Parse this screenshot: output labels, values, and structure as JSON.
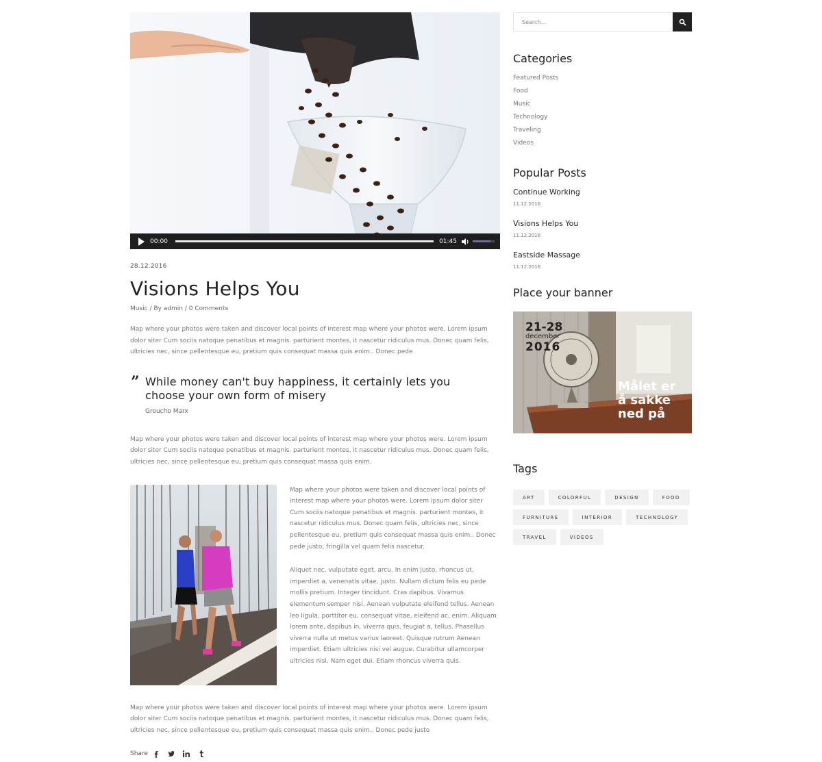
{
  "video": {
    "current_time": "00:00",
    "duration": "01:45",
    "progress": 0.0,
    "volume": 0.8
  },
  "post": {
    "date": "28.12.2016",
    "title": "Visions Helps You",
    "category": "Music",
    "by_label": "By",
    "author": "admin",
    "comments": "0 Comments",
    "paragraph_1": "Map where your photos were taken and discover local points of interest map where your photos were. Lorem ipsum dolor siter Cum sociis natoque penatibus et magnis. parturient montes, it nascetur ridiculus mus. Donec quam felis, ultricies nec, since pellentesque eu, pretium quis consequat massa quis enim.. Donec pede",
    "quote": "While money can't buy happiness, it certainly lets you choose your own form of misery",
    "quote_author": "Groucho Marx",
    "paragraph_2": "Map where your photos were taken and discover local points of interest map where your photos were. Lorem ipsum dolor siter Cum sociis natoque penatibus et magnis. parturient montes, it nascetur ridiculus mus. Donec quam felis, ultricies nec, since pellentesque eu, pretium quis consequat massa quis enim.",
    "side_paragraph_1": "Map where your photos were taken and discover local points of interest map where your photos were. Lorem ipsum dolor siter Cum sociis natoque penatibus et magnis. parturient montes, it nascetur ridiculus mus. Donec quam felis, ultricies nec, since pellentesque eu, pretium quis consequat  massa quis enim.. Donec pede justo, fringilla vel quam felis nascetur.",
    "side_paragraph_2": "Aliquet nec, vulputate eget, arcu. In enim justo, rhoncus ut, imperdiet a, venenatis vitae, justo. Nullam dictum felis eu pede mollis pretium. Integer tincidunt. Cras dapibus. Vivamus elementum semper nisi. Aenean vulputate eleifend tellus. Aenean leo ligula, porttitor eu, consequat vitae, eleifend ac, enim. Aliquam lorem ante, dapibus in, viverra quis, feugiat a, tellus. Phasellus viverra nulla ut metus varius laoreet. Quisque rutrum Aenean imperdiet. Etiam ultricies nisi vel augue. Curabitur ullamcorper ultricies nisi. Nam eget dui. Etiam rhoncus viverra quis.",
    "paragraph_3": "Map where your photos were taken and discover local points of interest map where your photos were. Lorem ipsum dolor siter Cum sociis natoque penatibus et magnis. parturient montes, it nascetur ridiculus mus. Donec quam felis, ultricies nec, since pellentesque eu, pretium quis consequat massa quis enim.. Donec pede justo",
    "share_label": "Share",
    "share_icons": [
      "facebook-icon",
      "twitter-icon",
      "linkedin-icon",
      "tumblr-icon"
    ]
  },
  "sidebar": {
    "search_placeholder": "Search...",
    "categories_title": "Categories",
    "categories": [
      "Featured Posts",
      "Food",
      "Music",
      "Technology",
      "Traveling",
      "Videos"
    ],
    "popular_title": "Popular Posts",
    "popular": [
      {
        "title": "Continue Working",
        "date": "11.12.2016"
      },
      {
        "title": "Visions Helps You",
        "date": "11.12.2016"
      },
      {
        "title": "Eastside Massage",
        "date": "11.12.2016"
      }
    ],
    "banner_title": "Place your banner",
    "banner": {
      "date_range": "21-28",
      "month": "december",
      "year": "2016",
      "line1": "Målet er",
      "line2": "å sakke",
      "line3": "ned på"
    },
    "tags_title": "Tags",
    "tags": [
      "ART",
      "COLORFUL",
      "DESIGN",
      "FOOD",
      "FURNITURE",
      "INTERIOR",
      "TECHNOLOGY",
      "TRAVEL",
      "VIDEOS"
    ]
  },
  "colors": {
    "text_dark": "#222222",
    "text_muted": "#777777",
    "tag_bg": "#f1f1f1",
    "player_bar": "#1e1e1e",
    "volume_accent": "#6c63d4"
  }
}
